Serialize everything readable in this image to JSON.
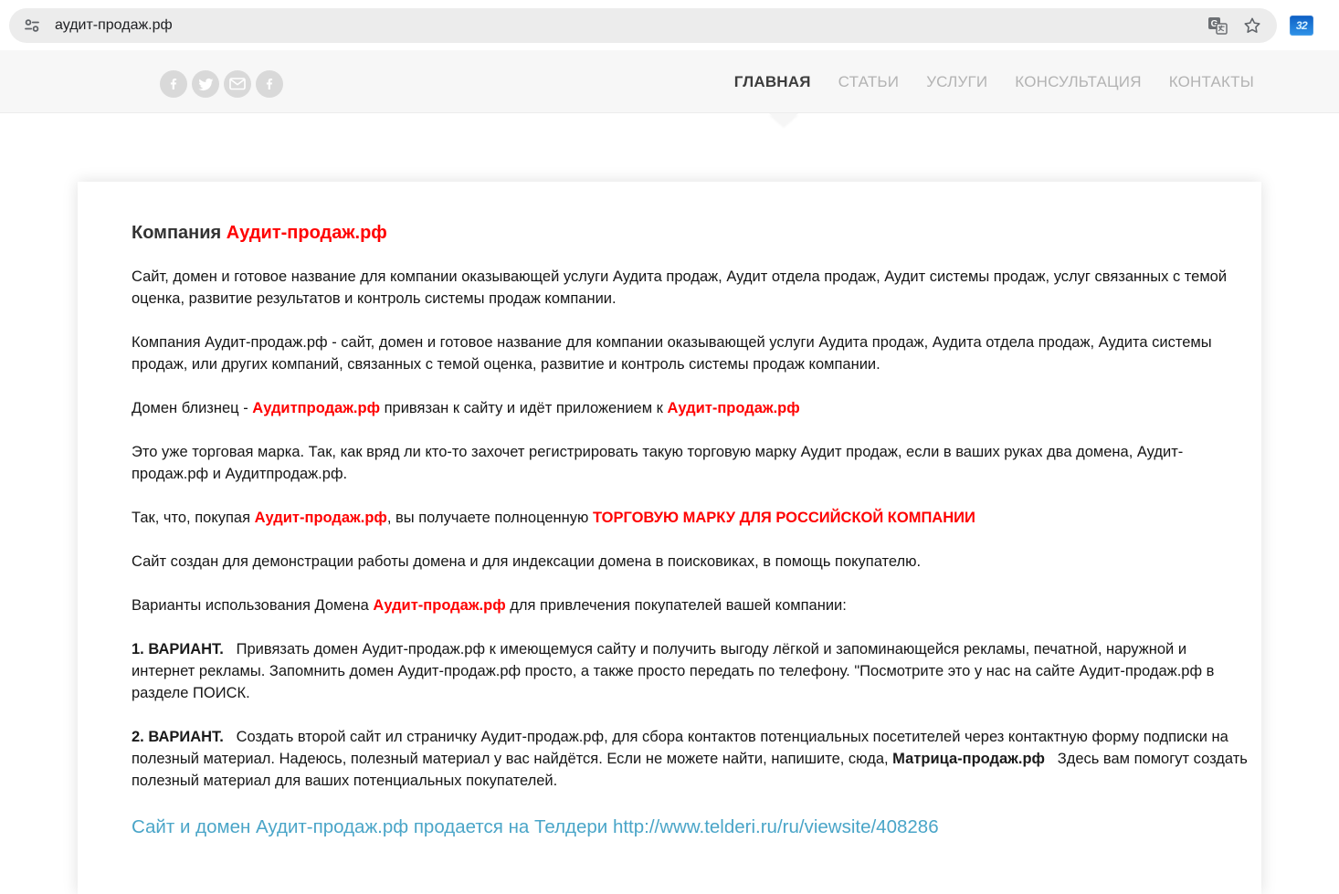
{
  "colors": {
    "accent_red": "#ff0000",
    "link_blue": "#4aa5c8",
    "nav_active": "#3d3d3d",
    "nav_inactive": "#b3b3b3",
    "header_bg": "#f7f7f7",
    "omnibox_bg": "#ececec"
  },
  "browser": {
    "url": "аудит-продаж.рф",
    "extension_badge": "32",
    "icons": [
      "site-settings",
      "translate",
      "bookmark-star"
    ]
  },
  "header": {
    "social": [
      "facebook",
      "twitter",
      "email",
      "facebook"
    ],
    "nav": [
      {
        "label": "ГЛАВНАЯ",
        "active": true
      },
      {
        "label": "СТАТЬИ",
        "active": false
      },
      {
        "label": "УСЛУГИ",
        "active": false
      },
      {
        "label": "КОНСУЛЬТАЦИЯ",
        "active": false
      },
      {
        "label": "КОНТАКТЫ",
        "active": false
      }
    ]
  },
  "content": {
    "heading": {
      "runs": [
        {
          "t": "Компания ",
          "s": "n"
        },
        {
          "t": "Аудит-продаж.рф",
          "s": "r"
        }
      ]
    },
    "paragraphs": [
      {
        "runs": [
          {
            "t": "Сайт, домен и готовое название для компании оказывающей услуги Аудита продаж, Аудит отдела продаж, Аудит системы продаж, услуг связанных с темой оценка, развитие результатов и контроль системы продаж компании.",
            "s": "n"
          }
        ]
      },
      {
        "runs": [
          {
            "t": "Компания Аудит-продаж.рф - сайт, домен и готовое название для компании оказывающей услуги Аудита продаж, Аудита отдела продаж, Аудита системы продаж, или других компаний, связанных с темой оценка, развитие и контроль системы продаж компании.",
            "s": "n"
          }
        ]
      },
      {
        "runs": [
          {
            "t": "Домен близнец - ",
            "s": "n"
          },
          {
            "t": "Аудитпродаж.рф",
            "s": "r"
          },
          {
            "t": " привязан к сайту и идёт приложением к ",
            "s": "n"
          },
          {
            "t": "Аудит-продаж.рф",
            "s": "r"
          }
        ]
      },
      {
        "runs": [
          {
            "t": "Это уже торговая марка. Так, как вряд ли кто-то захочет регистрировать такую торговую марку Аудит продаж, если в ваших руках два домена, Аудит-продаж.рф и Аудитпродаж.рф.",
            "s": "n"
          }
        ]
      },
      {
        "runs": [
          {
            "t": "Так, что, покупая ",
            "s": "n"
          },
          {
            "t": "Аудит-продаж.рф",
            "s": "r"
          },
          {
            "t": ", вы получаете полноценную ",
            "s": "n"
          },
          {
            "t": "ТОРГОВУЮ МАРКУ ДЛЯ РОССИЙСКОЙ КОМПАНИИ",
            "s": "r"
          }
        ]
      },
      {
        "runs": [
          {
            "t": "Сайт создан для демонстрации работы домена и для индексации домена в поисковиках, в помощь покупателю.",
            "s": "n"
          }
        ]
      },
      {
        "runs": [
          {
            "t": "Варианты использования Домена ",
            "s": "n"
          },
          {
            "t": "Аудит-продаж.рф",
            "s": "r"
          },
          {
            "t": " для привлечения покупателей вашей компании:",
            "s": "n"
          }
        ]
      },
      {
        "runs": [
          {
            "t": "1. ВАРИАНТ.",
            "s": "b"
          },
          {
            "t": "   Привязать домен Аудит-продаж.рф к имеющемуся сайту и получить выгоду лёгкой и запоминающейся рекламы, печатной, наружной и интернет рекламы. Запомнить домен Аудит-продаж.рф просто, а также просто передать по телефону. \"Посмотрите это у нас на сайте Аудит-продаж.рф в разделе ПОИСК.",
            "s": "n"
          }
        ]
      },
      {
        "runs": [
          {
            "t": "2. ВАРИАНТ.",
            "s": "b"
          },
          {
            "t": "   Создать второй сайт ил страничку Аудит-продаж.рф, для сбора контактов потенциальных посетителей через контактную форму подписки на полезный материал. Надеюсь, полезный материал у вас найдётся. Если не можете найти, напишите, сюда, ",
            "s": "n"
          },
          {
            "t": "Матрица-продаж.рф",
            "s": "b"
          },
          {
            "t": "   Здесь вам помогут создать полезный материал для ваших потенциальных покупателей.",
            "s": "n"
          }
        ]
      }
    ],
    "link": {
      "text": "Сайт и домен Аудит-продаж.рф продается на Телдери http://www.telderi.ru/ru/viewsite/408286"
    }
  }
}
